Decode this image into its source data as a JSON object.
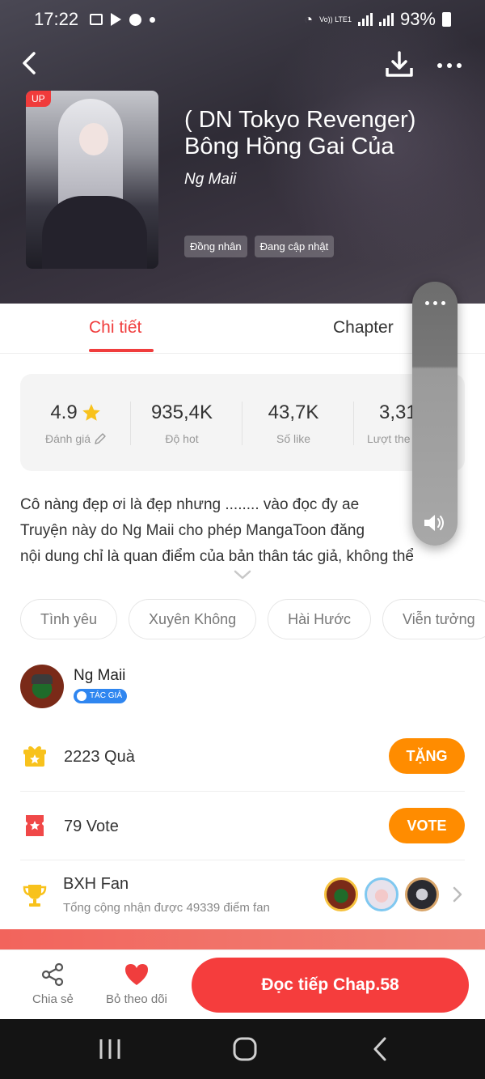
{
  "status_bar": {
    "time": "17:22",
    "network": "Vo)) LTE1",
    "battery": "93%"
  },
  "header": {
    "up_badge": "UP",
    "title": "( DN Tokyo Revenger) Bông Hồng Gai Của",
    "author": "Ng Maii",
    "tags": [
      "Đồng nhân",
      "Đang cập nhật"
    ]
  },
  "tabs": [
    {
      "label": "Chi tiết",
      "active": true
    },
    {
      "label": "Chapter",
      "active": false
    }
  ],
  "stats": [
    {
      "value": "4.9",
      "label": "Đánh giá"
    },
    {
      "value": "935,4K",
      "label": "Độ hot"
    },
    {
      "value": "43,7K",
      "label": "Số like"
    },
    {
      "value": "3,31",
      "label": "Lượt the"
    }
  ],
  "description": [
    "Cô nàng đẹp ơi là đẹp nhưng ........ vào đọc đy ae",
    "Truyện này do Ng Maii cho phép MangaToon đăng",
    "nội dung chỉ là quan điểm của bản thân tác giả, không thể"
  ],
  "genres": [
    "Tình yêu",
    "Xuyên Không",
    "Hài Hước",
    "Viễn tưởng"
  ],
  "author_row": {
    "name": "Ng Maii",
    "badge": "TÁC GIẢ"
  },
  "gifts": {
    "text": "2223  Quà",
    "button": "TẶNG"
  },
  "votes": {
    "text": "79  Vote",
    "button": "VOTE"
  },
  "fan_ranking": {
    "title": "BXH Fan",
    "subtitle": "Tổng cộng nhận được 49339 điểm fan"
  },
  "bottom_bar": {
    "share": "Chia sẻ",
    "unfollow": "Bỏ theo dõi",
    "read": "Đọc tiếp Chap.58"
  },
  "colors": {
    "accent": "#f03d3d",
    "orange": "#ff8c00",
    "header_bg": "#35323c"
  }
}
